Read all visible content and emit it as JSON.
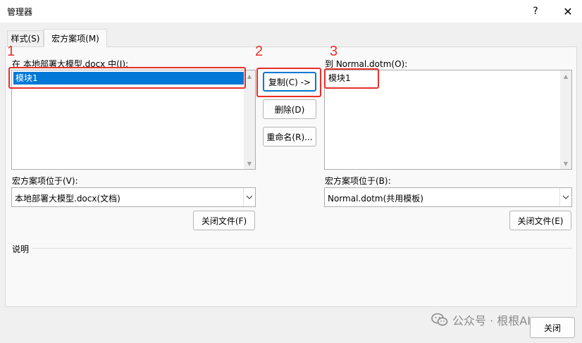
{
  "window": {
    "title": "管理器",
    "help": "?",
    "close": "✕"
  },
  "tabs": [
    {
      "label": "样式(S)"
    },
    {
      "label": "宏方案项(M)"
    }
  ],
  "left": {
    "list_label": "在 本地部署大模型.docx 中(I):",
    "items": [
      "模块1"
    ],
    "location_label": "宏方案项位于(V):",
    "location_value": "本地部署大模型.docx(文档)",
    "close_file": "关闭文件(F)"
  },
  "middle": {
    "copy": "复制(C) ->",
    "delete": "删除(D)",
    "rename": "重命名(R)..."
  },
  "right": {
    "list_label": "到 Normal.dotm(O):",
    "items": [
      "模块1"
    ],
    "location_label": "宏方案项位于(B):",
    "location_value": "Normal.dotm(共用模板)",
    "close_file": "关闭文件(E)"
  },
  "description_label": "说明",
  "annotations": {
    "one": "1",
    "two": "2",
    "three": "3"
  },
  "watermark": "公众号 · 根根AI",
  "footer": {
    "close": "关闭"
  },
  "colors": {
    "annotation": "#e8302a",
    "selection": "#0078d7"
  }
}
